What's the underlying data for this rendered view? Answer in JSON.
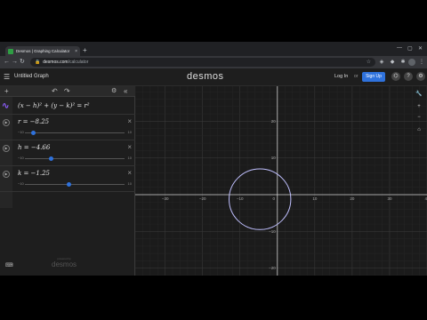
{
  "browser": {
    "tab_title": "Desmos | Graphing Calculator",
    "tab_close": "×",
    "new_tab": "+",
    "url_host": "desmos.com",
    "url_path": "/calculator",
    "nav_back": "←",
    "nav_forward": "→",
    "nav_reload": "↻"
  },
  "header": {
    "menu": "☰",
    "graph_title": "Untitled Graph",
    "brand": "desmos",
    "login": "Log In",
    "or": "or",
    "signup": "Sign Up",
    "icons": [
      "translate-icon",
      "help-icon",
      "settings-icon"
    ]
  },
  "panel": {
    "add": "+",
    "undo": "↶",
    "redo": "↷",
    "settings": "⚙",
    "collapse": "«",
    "expressions": [
      {
        "latex": "(x − h)² + (y − k)² = r²",
        "type": "equation"
      },
      {
        "latex": "r = −8.25",
        "type": "slider",
        "min": "−10",
        "max": "10",
        "value": -8.25
      },
      {
        "latex": "h = −4.66",
        "type": "slider",
        "min": "−10",
        "max": "10",
        "value": -4.66
      },
      {
        "latex": "k = −1.25",
        "type": "slider",
        "min": "−10",
        "max": "10",
        "value": -1.25
      }
    ],
    "keyboard": "⌨",
    "powered_by": "powered by",
    "powered_brand": "desmos"
  },
  "graph": {
    "x_ticks": [
      "−30",
      "−20",
      "−10",
      "0",
      "10",
      "20",
      "30",
      "40"
    ],
    "y_ticks": [
      "20",
      "10",
      "−10",
      "−20"
    ],
    "controls": [
      "wrench-icon",
      "zoom-in-icon",
      "zoom-out-icon",
      "home-icon"
    ],
    "circle": {
      "h": -4.66,
      "k": -1.25,
      "r": 8.25,
      "color": "#c0c0ff"
    },
    "x_range": [
      -38,
      40
    ],
    "y_range": [
      -22,
      29.5
    ]
  }
}
